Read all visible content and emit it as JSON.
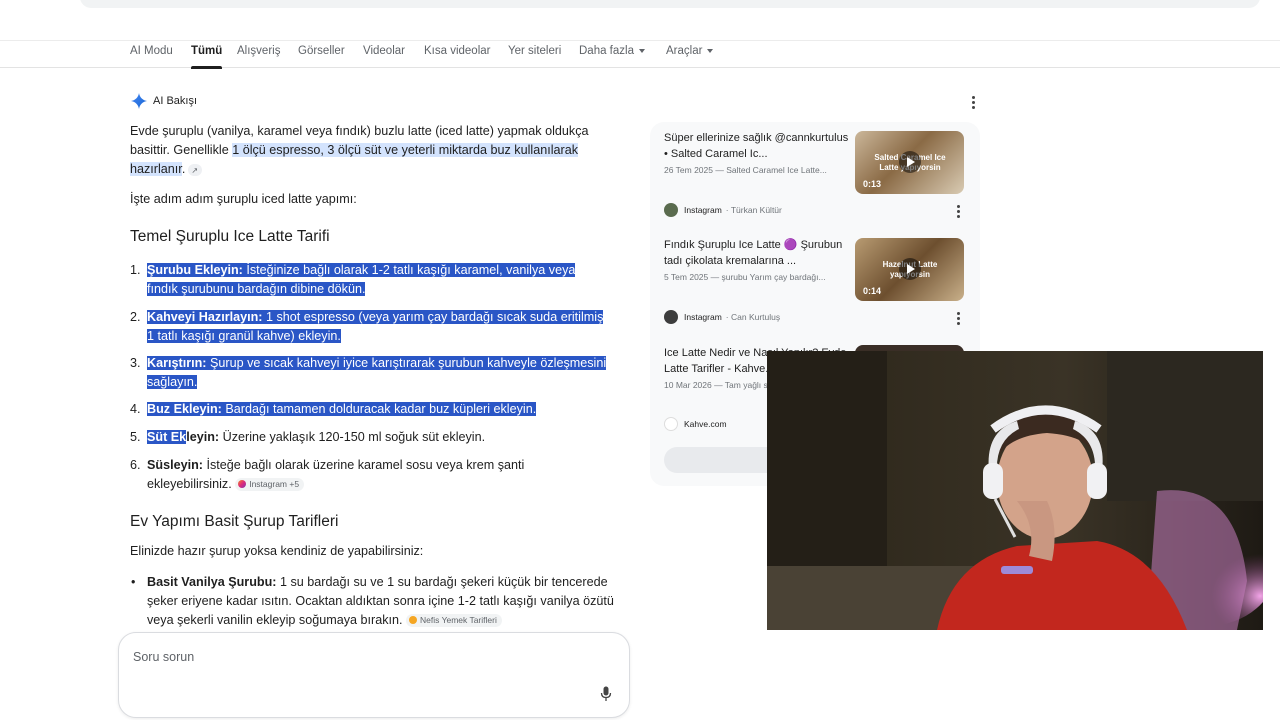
{
  "tabs": [
    {
      "label": "AI Modu",
      "active": false
    },
    {
      "label": "Tümü",
      "active": true
    },
    {
      "label": "Alışveriş",
      "active": false
    },
    {
      "label": "Görseller",
      "active": false
    },
    {
      "label": "Videolar",
      "active": false
    },
    {
      "label": "Kısa videolar",
      "active": false
    },
    {
      "label": "Yer siteleri",
      "active": false
    },
    {
      "label": "Daha fazla",
      "active": false,
      "dropdown": true
    },
    {
      "label": "Araçlar",
      "active": false,
      "dropdown": true
    }
  ],
  "ai_overview": {
    "label": "AI Bakışı",
    "intro_a": "Evde şuruplu (vanilya, karamel veya fındık) buzlu latte (iced latte) yapmak oldukça basittir. Genellikle ",
    "intro_highlight": "1 ölçü espresso, 3 ölçü süt ve yeterli miktarda buz kullanılarak hazırlanır",
    "intro_end": ".",
    "steps_intro": "İşte adım adım şuruplu iced latte yapımı:",
    "recipe_heading": "Temel Şuruplu Ice Latte Tarifi",
    "steps": [
      {
        "num": "1.",
        "bold": "Şurubu Ekleyin:",
        "text": " İsteğinize bağlı olarak 1-2 tatlı kaşığı karamel, vanilya veya fındık şurubunu bardağın dibine dökün."
      },
      {
        "num": "2.",
        "bold": "Kahveyi Hazırlayın:",
        "text": " 1 shot espresso (veya yarım çay bardağı sıcak suda eritilmiş 1 tatlı kaşığı granül kahve) ekleyin."
      },
      {
        "num": "3.",
        "bold": "Karıştırın:",
        "text": " Şurup ve sıcak kahveyi iyice karıştırarak şurubun kahveyle özleşmesini sağlayın."
      },
      {
        "num": "4.",
        "bold": "Buz Ekleyin:",
        "text": " Bardağı tamamen dolduracak kadar buz küpleri ekleyin."
      },
      {
        "num": "5.",
        "bold_sel": "Süt Ek",
        "bold_rest": "leyin:",
        "text": " Üzerine yaklaşık 120-150 ml soğuk süt ekleyin."
      },
      {
        "num": "6.",
        "bold": "Süslеyin:",
        "text": " İsteğe bağlı olarak üzerine karamel sosu veya krem şanti ekleyebilirsiniz."
      }
    ],
    "step6_source": "Instagram +5",
    "syrup_heading": "Ev Yapımı Basit Şurup Tarifleri",
    "syrup_intro": "Elinizde hazır şurup yoksa kendiniz de yapabilirsiniz:",
    "bullet_bold": "Basit Vanilya Şurubu:",
    "bullet_text": " 1 su bardağı su ve 1 su bardağı şekeri küçük bir tencerede şeker eriyene kadar ısıtın. Ocaktan aldıktan sonra içine 1-2 tatlı kaşığı vanilya özütü veya şekerli vanilin ekleyip soğumaya bırakın.",
    "bullet_source": "Nefis Yemek Tarifleri"
  },
  "ask_box": {
    "placeholder": "Soru sorun"
  },
  "sources": [
    {
      "title": "Süper ellerinize sağlık @cannkurtulus • Salted Caramel Ic...",
      "meta": "26 Tem 2025 — Salted Caramel Ice Latte...",
      "thumb_caption": "Salted Caramel Ice Latte yapıyorsin",
      "duration": "0:13",
      "site": "Instagram",
      "author": "Türkan Kültür"
    },
    {
      "title": "Fındık Şuruplu Ice Latte 🟣 Şurubun tadı çikolata kremalarına ...",
      "meta": "5 Tem 2025 — şurubu Yarım çay bardağı...",
      "thumb_caption": "Hazelnut Latte yapıyorsin",
      "duration": "0:14",
      "site": "Instagram",
      "author": "Can Kurtuluş"
    },
    {
      "title": "Ice Latte Nedir ve Nasıl Yapılır? Evde Latte Tarifler - Kahve.com",
      "meta": "10 Mar 2026 — Tam yağlı süt ice latte için popüler",
      "site": "Kahve.com"
    }
  ],
  "colors": {
    "selection": "#2a56c6",
    "highlight": "#d3e3fd",
    "accent": "#1a73e8"
  }
}
